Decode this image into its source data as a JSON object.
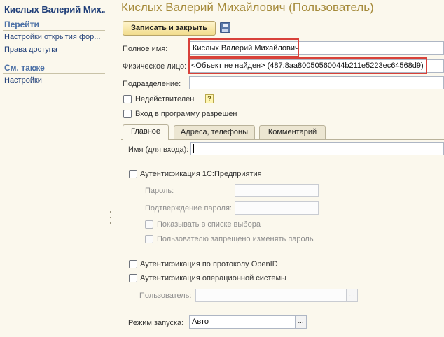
{
  "sidebar": {
    "title": "Кислых Валерий Мих...",
    "goto_heading": "Перейти",
    "goto_items": [
      "Настройки открытия фор...",
      "Права доступа"
    ],
    "see_also_heading": "См. также",
    "see_also_items": [
      "Настройки"
    ]
  },
  "header": {
    "title": "Кислых Валерий Михайлович (Пользователь)"
  },
  "toolbar": {
    "save_close_label": "Записать и закрыть",
    "save_icon": "floppy-disk-icon"
  },
  "form": {
    "full_name_label": "Полное имя:",
    "full_name_value": "Кислых Валерий Михайлович",
    "person_label": "Физическое лицо:",
    "person_value": "<Объект не найден> (487:8aa80050560044b211e5223ec64568d9)",
    "department_label": "Подразделение:",
    "department_value": "",
    "invalid_label": "Недействителен",
    "invalid_checked": false,
    "help_glyph": "?",
    "login_allowed_label": "Вход в программу разрешен",
    "login_allowed_checked": false
  },
  "tabs": [
    {
      "label": "Главное",
      "active": true
    },
    {
      "label": "Адреса, телефоны",
      "active": false
    },
    {
      "label": "Комментарий",
      "active": false
    }
  ],
  "main_tab": {
    "login_name_label": "Имя (для входа):",
    "login_name_value": "",
    "auth_1c_label": "Аутентификация 1С:Предприятия",
    "password_label": "Пароль:",
    "password_confirm_label": "Подтверждение пароля:",
    "show_in_list_label": "Показывать в списке выбора",
    "forbid_change_password_label": "Пользователю запрещено изменять пароль",
    "auth_openid_label": "Аутентификация по протоколу OpenID",
    "auth_os_label": "Аутентификация операционной системы",
    "os_user_label": "Пользователь:",
    "os_user_value": "",
    "launch_mode_label": "Режим запуска:",
    "launch_mode_value": "Авто",
    "dots_glyph": "..."
  },
  "colors": {
    "title": "#a58a3a",
    "highlight_box": "#d8413a",
    "link": "#1f3e78"
  }
}
